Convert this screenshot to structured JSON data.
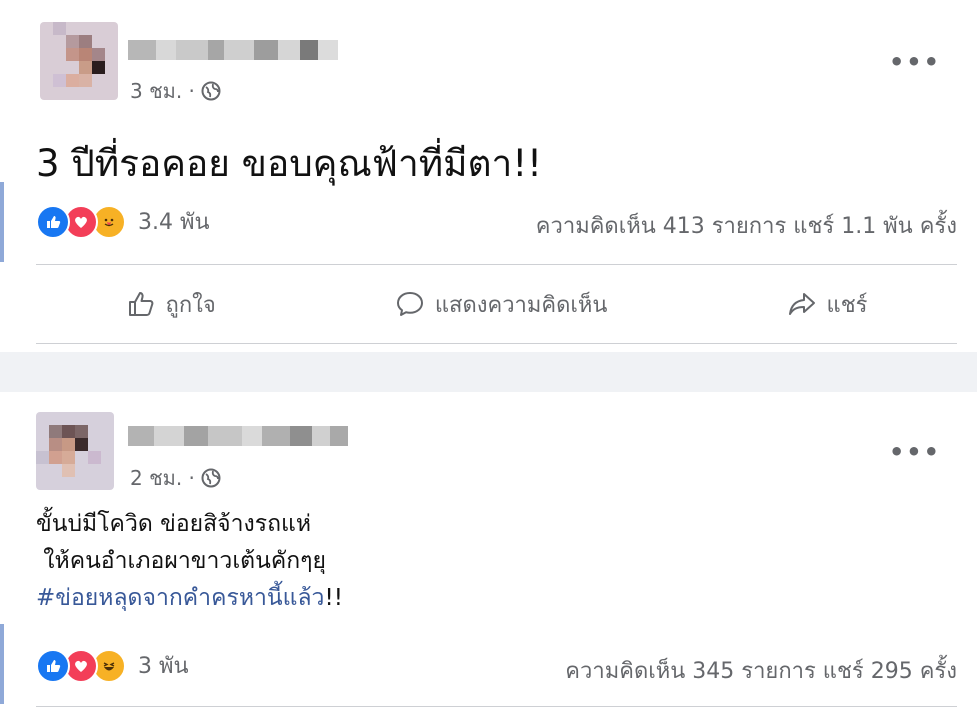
{
  "posts": [
    {
      "time": "3 ชม. ·",
      "icons": [
        "globe-icon",
        "more-icon"
      ],
      "more": "•••",
      "text": "3 ปีที่รอคอย ขอบคุณฟ้าที่มีตา!!",
      "reactions": [
        "like-icon",
        "love-icon",
        "care-icon"
      ],
      "reaction_count": "3.4 พัน",
      "stats": "ความคิดเห็น 413 รายการ แชร์ 1.1 พัน ครั้ง",
      "actions": {
        "like": "ถูกใจ",
        "comment": "แสดงความคิดเห็น",
        "share": "แชร์"
      }
    },
    {
      "time": "2 ชม. ·",
      "icons": [
        "globe-icon",
        "more-icon"
      ],
      "more": "•••",
      "line1": "ขั้นบ่มีโควิด ข่อยสิจ้างรถแห่",
      "line2": " ให้คนอำเภอผาขาวเต้นคักๆยุ",
      "hashtag": "#ข่อยหลุดจากคำครหานี้แล้ว",
      "suffix": "!!",
      "reactions": [
        "like-icon",
        "love-icon",
        "haha-icon"
      ],
      "reaction_count": "3 พัน",
      "stats": "ความคิดเห็น 345 รายการ แชร์ 295 ครั้ง"
    }
  ],
  "colors": {
    "like": "#1877f2",
    "love": "#f33e58",
    "emoji": "#f7b125",
    "link": "#385898",
    "meta": "#65676b"
  }
}
